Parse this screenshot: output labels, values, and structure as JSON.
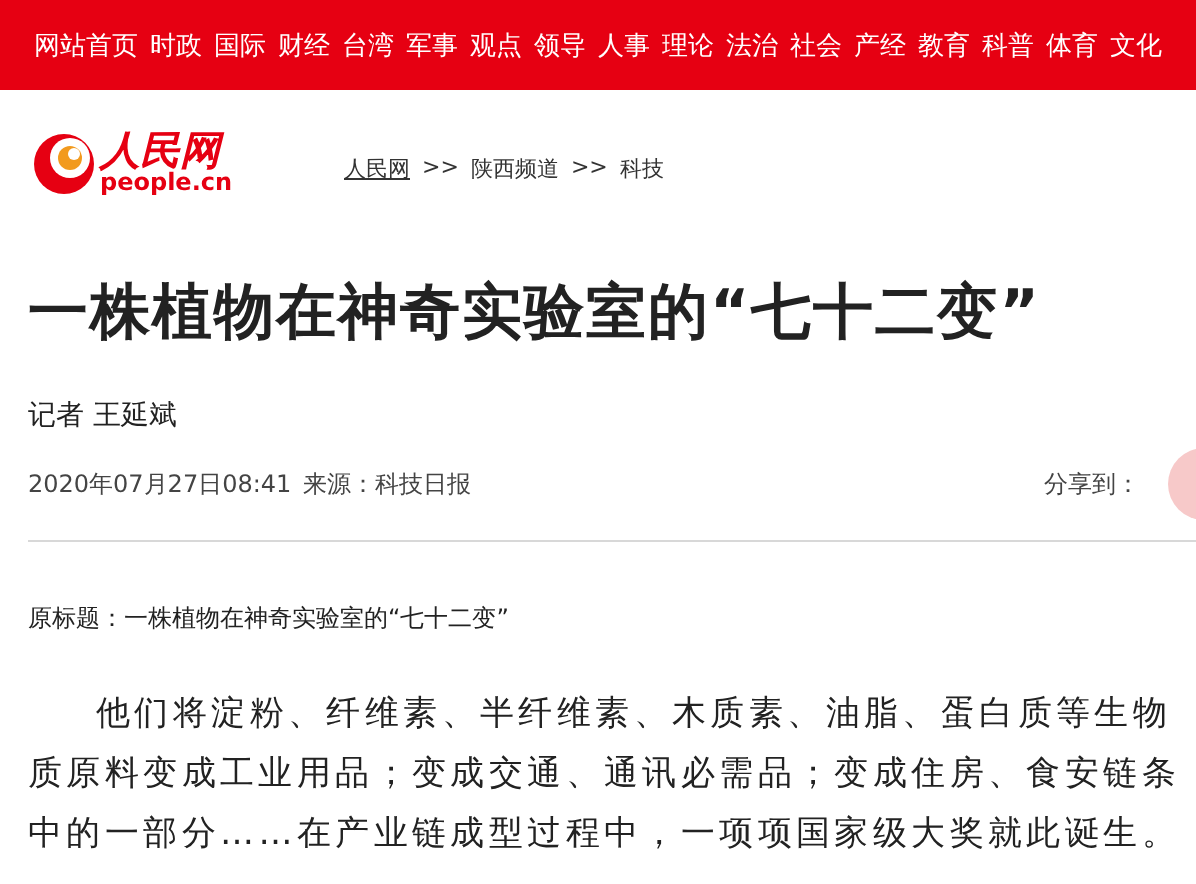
{
  "nav": [
    "网站首页",
    "时政",
    "国际",
    "财经",
    "台湾",
    "军事",
    "观点",
    "领导",
    "人事",
    "理论",
    "法治",
    "社会",
    "产经",
    "教育",
    "科普",
    "体育",
    "文化"
  ],
  "logo": {
    "title": "人民网",
    "domain": "people.cn"
  },
  "breadcrumb": [
    "人民网",
    "陕西频道",
    "科技"
  ],
  "breadcrumb_separator": ">>",
  "headline": "一株植物在神奇实验室的“七十二变”",
  "reporter": "记者 王延斌",
  "date": "2020年07月27日08:41",
  "source": "来源：科技日报",
  "share_label": "分享到：",
  "original_title": "原标题：一株植物在神奇实验室的“七十二变”",
  "paragraph": "他们将淀粉、纤维素、半纤维素、木质素、油脂、蛋白质等生物质原料变成工业用品；变成交通、通讯必需品；变成住房、食安链条中的一部分……在产业链成型过程中，一项项国家级大奖就此诞生。"
}
